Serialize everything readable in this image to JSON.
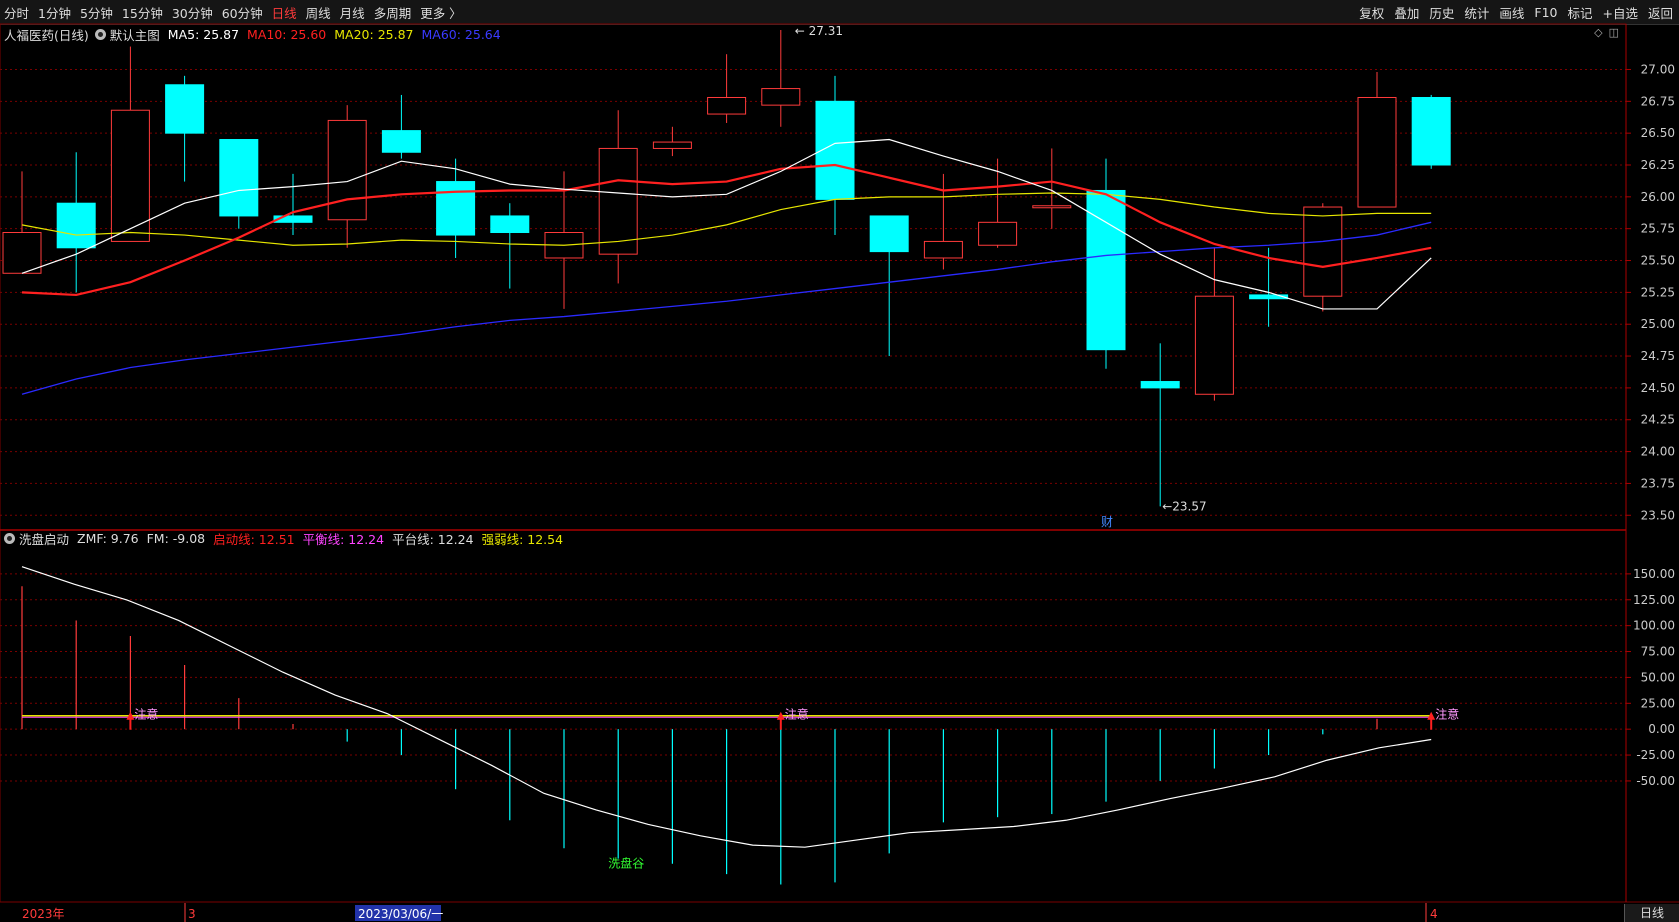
{
  "toolbar": {
    "periods": [
      {
        "label": "分时",
        "active": false
      },
      {
        "label": "1分钟",
        "active": false
      },
      {
        "label": "5分钟",
        "active": false
      },
      {
        "label": "15分钟",
        "active": false
      },
      {
        "label": "30分钟",
        "active": false
      },
      {
        "label": "60分钟",
        "active": false
      },
      {
        "label": "日线",
        "active": true
      },
      {
        "label": "周线",
        "active": false
      },
      {
        "label": "月线",
        "active": false
      },
      {
        "label": "多周期",
        "active": false
      },
      {
        "label": "更多 〉",
        "active": false
      }
    ],
    "right_items": [
      "复权",
      "叠加",
      "历史",
      "统计",
      "画线",
      "F10",
      "标记",
      "+自选",
      "返回"
    ]
  },
  "main_info": {
    "stock_title": "人福医药(日线)",
    "template": "默认主图",
    "ma5": "MA5: 25.87",
    "ma10": "MA10: 25.60",
    "ma20": "MA20: 25.87",
    "ma60": "MA60: 25.64"
  },
  "sub_info": {
    "indicator": "洗盘启动",
    "zmf": "ZMF: 9.76",
    "fm": "FM: -9.08",
    "qidong": "启动线: 12.51",
    "pingheng": "平衡线: 12.24",
    "pingtai": "平台线: 12.24",
    "qiangruo": "强弱线: 12.54"
  },
  "colors": {
    "up": "#ff3b3b",
    "down": "#00ffff",
    "ma5": "#ffffff",
    "ma10": "#ff2020",
    "ma20": "#e6e600",
    "ma60": "#2a2aff",
    "grid": "#7a0000",
    "axis": "#ccc",
    "purple": "#ff44ff"
  },
  "annotations": {
    "high": "27.31",
    "low": "23.57",
    "cai": "财",
    "xipan_gu": "洗盘谷",
    "zhuyi": "注意"
  },
  "dates": {
    "year": "2023年",
    "mar": "3",
    "apr": "4",
    "cursor": "2023/03/06/一"
  },
  "bottom_tab": "日线",
  "chart_data": [
    {
      "type": "candlestick",
      "title": "人福医药(日线)",
      "ylim": [
        23.4,
        27.2
      ],
      "y_ticks": [
        23.5,
        23.75,
        24.0,
        24.25,
        24.5,
        24.75,
        25.0,
        25.25,
        25.5,
        25.75,
        26.0,
        26.25,
        26.5,
        26.75,
        27.0
      ],
      "candles": [
        {
          "o": 25.4,
          "c": 25.72,
          "h": 26.2,
          "l": 25.4
        },
        {
          "o": 25.95,
          "c": 25.6,
          "h": 26.35,
          "l": 25.25
        },
        {
          "o": 25.65,
          "c": 26.68,
          "h": 27.18,
          "l": 25.65
        },
        {
          "o": 26.88,
          "c": 26.5,
          "h": 26.95,
          "l": 26.12
        },
        {
          "o": 26.45,
          "c": 25.85,
          "h": 26.45,
          "l": 25.75
        },
        {
          "o": 25.85,
          "c": 25.8,
          "h": 26.18,
          "l": 25.7
        },
        {
          "o": 25.82,
          "c": 26.6,
          "h": 26.72,
          "l": 25.6
        },
        {
          "o": 26.52,
          "c": 26.35,
          "h": 26.8,
          "l": 26.3
        },
        {
          "o": 26.12,
          "c": 25.7,
          "h": 26.3,
          "l": 25.52
        },
        {
          "o": 25.85,
          "c": 25.72,
          "h": 25.95,
          "l": 25.28
        },
        {
          "o": 25.52,
          "c": 25.72,
          "h": 26.2,
          "l": 25.12
        },
        {
          "o": 25.55,
          "c": 26.38,
          "h": 26.68,
          "l": 25.32
        },
        {
          "o": 26.38,
          "c": 26.43,
          "h": 26.55,
          "l": 26.32
        },
        {
          "o": 26.65,
          "c": 26.78,
          "h": 27.12,
          "l": 26.58
        },
        {
          "o": 26.72,
          "c": 26.85,
          "h": 27.31,
          "l": 26.55
        },
        {
          "o": 26.75,
          "c": 25.98,
          "h": 26.95,
          "l": 25.7
        },
        {
          "o": 25.85,
          "c": 25.57,
          "h": 25.85,
          "l": 24.75
        },
        {
          "o": 25.52,
          "c": 25.65,
          "h": 26.18,
          "l": 25.43
        },
        {
          "o": 25.62,
          "c": 25.8,
          "h": 26.3,
          "l": 25.6
        },
        {
          "o": 25.93,
          "c": 25.93,
          "h": 26.38,
          "l": 25.75
        },
        {
          "o": 26.05,
          "c": 24.8,
          "h": 26.3,
          "l": 24.65
        },
        {
          "o": 24.55,
          "c": 24.5,
          "h": 24.85,
          "l": 23.57
        },
        {
          "o": 24.45,
          "c": 25.22,
          "h": 25.6,
          "l": 24.4
        },
        {
          "o": 25.23,
          "c": 25.2,
          "h": 25.6,
          "l": 24.98
        },
        {
          "o": 25.22,
          "c": 25.92,
          "h": 25.95,
          "l": 25.1
        },
        {
          "o": 25.92,
          "c": 26.78,
          "h": 26.98,
          "l": 25.92
        },
        {
          "o": 26.78,
          "c": 26.25,
          "h": 26.8,
          "l": 26.22
        }
      ],
      "ma5": [
        25.4,
        25.55,
        25.75,
        25.95,
        26.05,
        26.08,
        26.12,
        26.28,
        26.22,
        26.1,
        26.06,
        26.03,
        26.0,
        26.02,
        26.2,
        26.42,
        26.45,
        26.32,
        26.2,
        26.05,
        25.8,
        25.55,
        25.35,
        25.25,
        25.12,
        25.12,
        25.52
      ],
      "ma10": [
        25.25,
        25.23,
        25.33,
        25.5,
        25.68,
        25.88,
        25.98,
        26.02,
        26.04,
        26.05,
        26.05,
        26.13,
        26.1,
        26.12,
        26.22,
        26.25,
        26.15,
        26.05,
        26.08,
        26.12,
        26.02,
        25.8,
        25.63,
        25.52,
        25.45,
        25.52,
        25.6
      ],
      "ma20": [
        25.78,
        25.7,
        25.72,
        25.7,
        25.66,
        25.62,
        25.63,
        25.66,
        25.65,
        25.63,
        25.62,
        25.65,
        25.7,
        25.78,
        25.9,
        25.98,
        26.0,
        26.0,
        26.02,
        26.03,
        26.02,
        25.98,
        25.92,
        25.87,
        25.85,
        25.87,
        25.87
      ],
      "ma60": [
        24.45,
        24.57,
        24.66,
        24.72,
        24.77,
        24.82,
        24.87,
        24.92,
        24.98,
        25.03,
        25.06,
        25.1,
        25.14,
        25.18,
        25.23,
        25.28,
        25.33,
        25.38,
        25.43,
        25.49,
        25.54,
        25.57,
        25.6,
        25.62,
        25.65,
        25.7,
        25.8
      ]
    },
    {
      "type": "bar",
      "title": "洗盘启动",
      "ylim": [
        -165,
        175
      ],
      "y_ticks": [
        -50,
        -25,
        0,
        25,
        50,
        75,
        100,
        125,
        150
      ],
      "bars": [
        138,
        105,
        90,
        62,
        30,
        5,
        -12,
        -25,
        -58,
        -88,
        -115,
        -125,
        -130,
        -140,
        -150,
        -148,
        -120,
        -90,
        -85,
        -82,
        -70,
        -50,
        -38,
        -25,
        -5,
        10,
        12
      ],
      "curve": [
        157,
        140,
        125,
        105,
        80,
        55,
        33,
        15,
        -10,
        -35,
        -62,
        -78,
        -92,
        -103,
        -112,
        -114,
        -107,
        -100,
        -97,
        -94,
        -88,
        -78,
        -67,
        -57,
        -46,
        -30,
        -18,
        -10
      ],
      "flat_line": 13,
      "signals": [
        2,
        14,
        26
      ]
    }
  ]
}
